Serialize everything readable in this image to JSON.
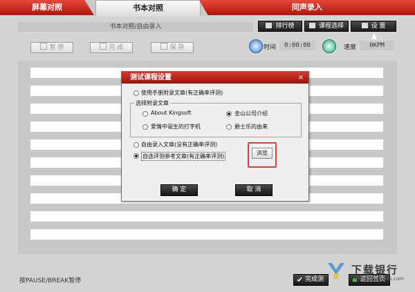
{
  "tabs": [
    {
      "label": "屏幕对照"
    },
    {
      "label": "书本对照"
    },
    {
      "label": "同声录入"
    }
  ],
  "header": {
    "breadcrumb": "书本对照/自由录入",
    "pause_label": "暂 停",
    "done_label": "完 成",
    "save_label": "保 存",
    "ranking_label": "排行榜",
    "course_label": "课程选择",
    "settings_label": "设  置",
    "time_label": "时间",
    "time_value": "0:00:00",
    "speed_label": "速度",
    "speed_value": "0KPM"
  },
  "dialog": {
    "title": "测试课程设置",
    "close": "×",
    "opt_manual": "使用手册附录文章(有正确率评测)",
    "group_label": "选择附录文章",
    "articles": [
      "About Kingsoft",
      "金山公司介绍",
      "爱情中诞生的打字机",
      "爵士乐的由来"
    ],
    "opt_free": "自由录入文章(没有正确率评测)",
    "opt_custom": "自选评测参考文章(有正确率评测)",
    "browse_label": "浏览",
    "ok_label": "确 定",
    "cancel_label": "取 消"
  },
  "footer": {
    "hint": "按PAUSE/BREAK暂停",
    "finish_label": "完成测",
    "return_label": "返回首页",
    "watermark_name": "下载银行",
    "watermark_url": "www.downbank.com"
  }
}
